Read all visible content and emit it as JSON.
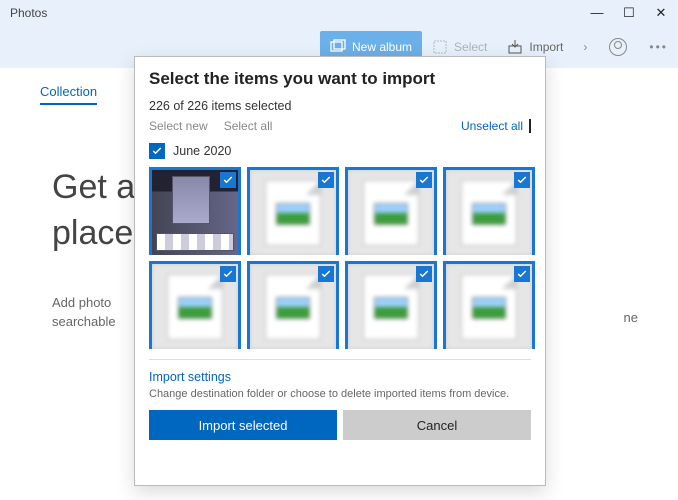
{
  "window": {
    "title": "Photos"
  },
  "header": {
    "new_album": "New album",
    "select": "Select",
    "import": "Import"
  },
  "nav": {
    "collection": "Collection"
  },
  "background": {
    "heading_line1": "Get a",
    "heading_line2": "place",
    "paragraph_line1": "Add photo",
    "paragraph_line2": "searchable",
    "paragraph_suffix": "ne"
  },
  "dialog": {
    "title": "Select the items you want to import",
    "count_text": "226 of 226 items selected",
    "select_new": "Select new",
    "select_all": "Select all",
    "unselect_all": "Unselect all",
    "date_group": "June 2020",
    "import_settings": "Import settings",
    "import_settings_help": "Change destination folder or choose to delete imported items from device.",
    "import_btn": "Import selected",
    "cancel_btn": "Cancel"
  },
  "thumbs": [
    {
      "selected": true,
      "kind": "photo"
    },
    {
      "selected": true,
      "kind": "placeholder"
    },
    {
      "selected": true,
      "kind": "placeholder"
    },
    {
      "selected": true,
      "kind": "placeholder"
    },
    {
      "selected": true,
      "kind": "placeholder"
    },
    {
      "selected": true,
      "kind": "placeholder"
    },
    {
      "selected": true,
      "kind": "placeholder"
    },
    {
      "selected": true,
      "kind": "placeholder"
    }
  ],
  "colors": {
    "accent": "#0067c0",
    "thumb_border": "#1976d2"
  }
}
